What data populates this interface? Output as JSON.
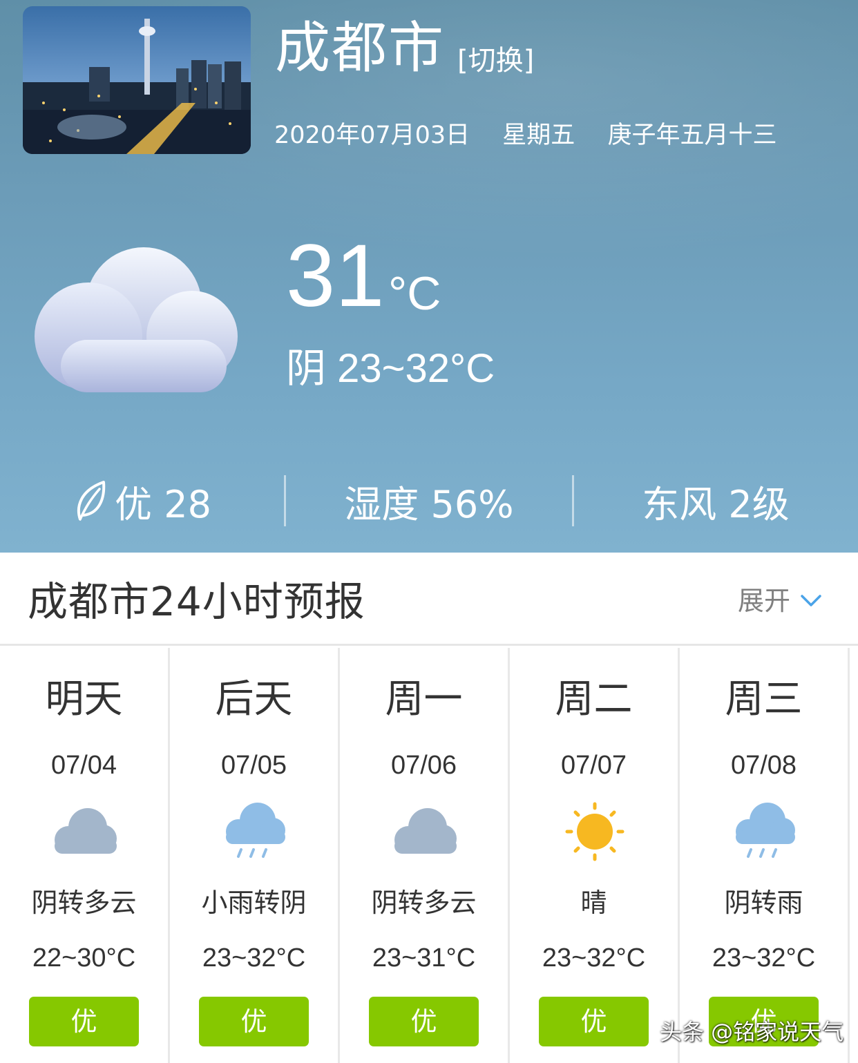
{
  "current": {
    "city": "成都市",
    "switch_label": "[切换]",
    "date": "2020年07月03日",
    "weekday": "星期五",
    "lunar": "庚子年五月十三",
    "icon": "cloud-icon",
    "temperature": "31",
    "unit": "°C",
    "condition_range": "阴 23~32°C"
  },
  "stats": {
    "aqi": "优 28",
    "aqi_icon": "leaf-icon",
    "humidity": "湿度 56%",
    "wind": "东风 2级"
  },
  "forecast": {
    "title": "成都市24小时预报",
    "expand_label": "展开",
    "days": [
      {
        "name": "明天",
        "date": "07/04",
        "icon": "cloudy-icon",
        "condition": "阴转多云",
        "range": "22~30°C",
        "aqi": "优"
      },
      {
        "name": "后天",
        "date": "07/05",
        "icon": "rain-icon",
        "condition": "小雨转阴",
        "range": "23~32°C",
        "aqi": "优"
      },
      {
        "name": "周一",
        "date": "07/06",
        "icon": "cloudy-icon",
        "condition": "阴转多云",
        "range": "23~31°C",
        "aqi": "优"
      },
      {
        "name": "周二",
        "date": "07/07",
        "icon": "sun-icon",
        "condition": "晴",
        "range": "23~32°C",
        "aqi": "优"
      },
      {
        "name": "周三",
        "date": "07/08",
        "icon": "rain-icon",
        "condition": "阴转雨",
        "range": "23~32°C",
        "aqi": "优"
      }
    ]
  },
  "colors": {
    "sky": "#6c9cb8",
    "aqi_badge": "#86c800",
    "cloud_grey": "#a3b6cb",
    "rain_blue": "#8fbde6",
    "sun_yellow": "#f7b821"
  },
  "watermark": "头条 @铭家说天气"
}
